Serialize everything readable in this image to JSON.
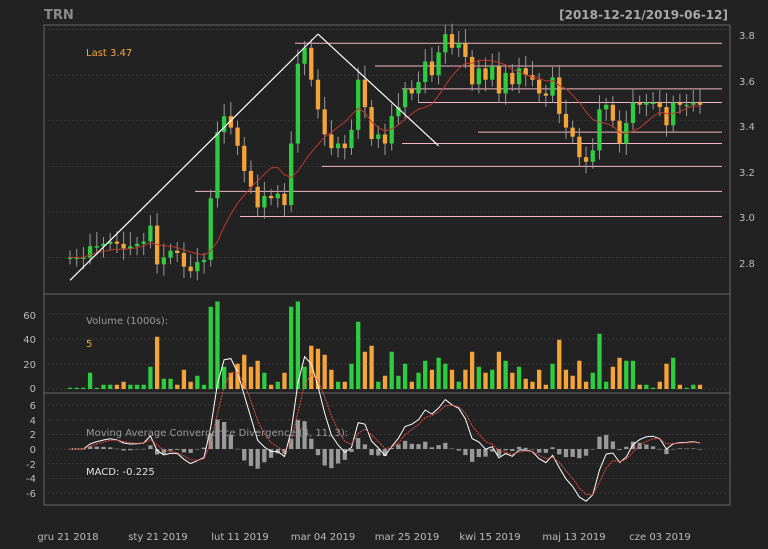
{
  "ticker": "TRN",
  "date_range": "[2018-12-21/2019-06-12]",
  "last_label": "Last 3.47",
  "volume_label": "Volume (1000s):",
  "volume_value": "5",
  "macd_title": "Moving Average Convergence Divergence (4, 11, 3):",
  "macd_label": "MACD: -0.225",
  "colors": {
    "up": "#2ecc40",
    "down": "#f5a43a",
    "hline": "#f4b6c2",
    "ma": "#c0392b",
    "macd_line": "#ffffff",
    "signal_line": "#e74c3c",
    "hist": "#9a9a9a"
  },
  "chart_data": [
    {
      "type": "candlestick",
      "x_ticks": [
        "gru 21 2018",
        "sty 21 2019",
        "lut 11 2019",
        "mar 04 2019",
        "mar 25 2019",
        "kwi 15 2019",
        "maj 13 2019",
        "cze 03 2019"
      ],
      "y_ticks": [
        "2.8",
        "3.0",
        "3.2",
        "3.4",
        "3.6",
        "3.8"
      ],
      "ylim": [
        2.64,
        3.82
      ],
      "closes": [
        2.8,
        2.8,
        2.8,
        2.85,
        2.85,
        2.86,
        2.87,
        2.86,
        2.84,
        2.85,
        2.86,
        2.87,
        2.94,
        2.77,
        2.8,
        2.83,
        2.82,
        2.76,
        2.74,
        2.78,
        2.79,
        3.06,
        3.35,
        3.42,
        3.37,
        3.29,
        3.18,
        3.11,
        3.02,
        3.07,
        3.06,
        3.08,
        3.03,
        3.3,
        3.65,
        3.72,
        3.58,
        3.45,
        3.34,
        3.28,
        3.3,
        3.28,
        3.36,
        3.58,
        3.46,
        3.32,
        3.34,
        3.3,
        3.42,
        3.46,
        3.54,
        3.52,
        3.57,
        3.66,
        3.6,
        3.7,
        3.78,
        3.72,
        3.74,
        3.68,
        3.56,
        3.63,
        3.58,
        3.64,
        3.52,
        3.61,
        3.56,
        3.63,
        3.6,
        3.58,
        3.52,
        3.51,
        3.59,
        3.43,
        3.37,
        3.33,
        3.24,
        3.22,
        3.27,
        3.45,
        3.47,
        3.4,
        3.3,
        3.39,
        3.48,
        3.47,
        3.48,
        3.48,
        3.46,
        3.38,
        3.48,
        3.47,
        3.47,
        3.48,
        3.47
      ],
      "series": [
        {
          "name": "Volume (1000s)",
          "y_ticks": [
            "0",
            "20",
            "40",
            "60"
          ]
        },
        {
          "name": "MACD",
          "y_ticks": [
            "6",
            "4",
            "2",
            "0",
            "-2",
            "-4",
            "-6"
          ]
        }
      ],
      "hlines": [
        3.74,
        3.64,
        3.54,
        3.48,
        3.35,
        3.3,
        3.2,
        3.09,
        2.98
      ],
      "trendlines": [
        [
          0,
          2.7,
          37,
          3.78
        ],
        [
          37,
          3.78,
          55,
          3.29
        ]
      ]
    }
  ]
}
